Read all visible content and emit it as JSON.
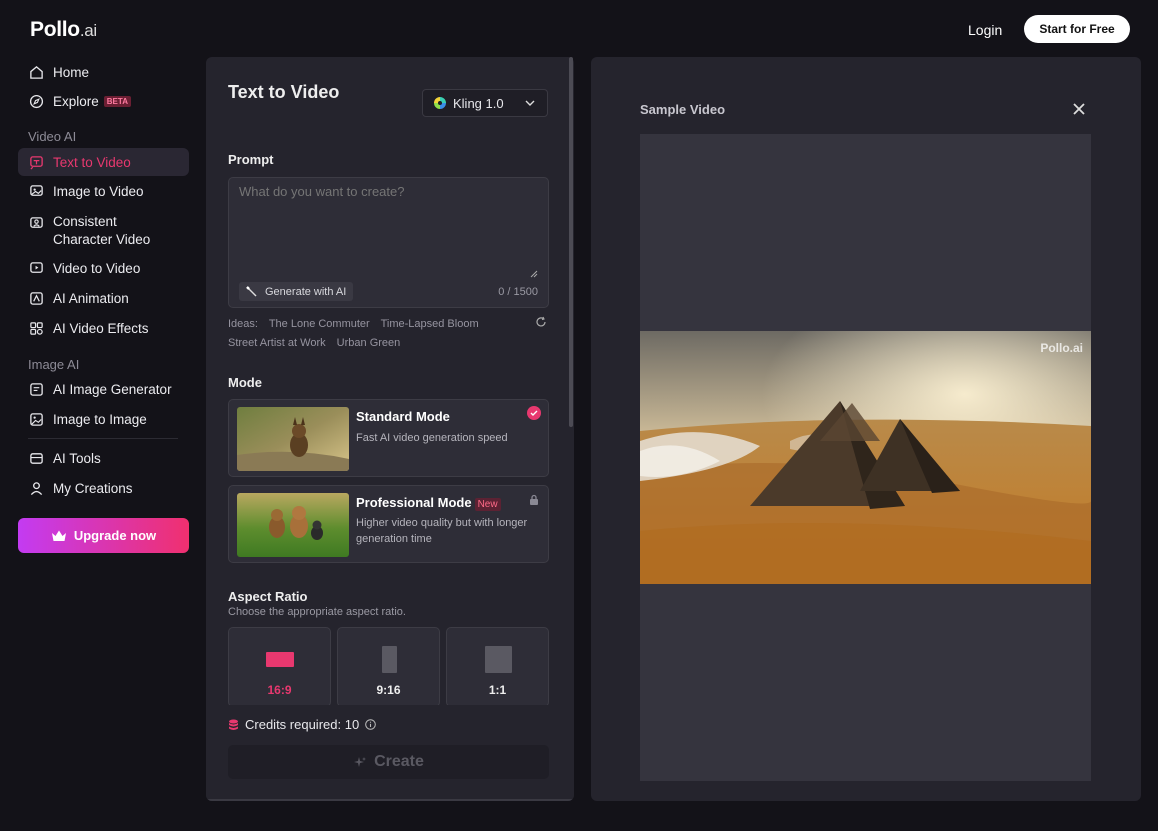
{
  "header": {
    "logo_main": "Pollo",
    "logo_suffix": ".ai",
    "login": "Login",
    "start_free": "Start for Free"
  },
  "sidebar": {
    "home": "Home",
    "explore": "Explore",
    "explore_badge": "BETA",
    "section_video": "Video AI",
    "text_to_video": "Text to Video",
    "image_to_video": "Image to Video",
    "consistent_1": "Consistent",
    "consistent_2": "Character Video",
    "video_to_video": "Video to Video",
    "ai_animation": "AI Animation",
    "ai_video_effects": "AI Video Effects",
    "section_image": "Image AI",
    "ai_image_generator": "AI Image Generator",
    "image_to_image": "Image to Image",
    "ai_tools": "AI Tools",
    "my_creations": "My Creations",
    "upgrade": "Upgrade now"
  },
  "panel": {
    "title": "Text to Video",
    "model": "Kling 1.0",
    "prompt_label": "Prompt",
    "prompt_placeholder": "What do you want to create?",
    "generate_ai": "Generate with AI",
    "counter": "0 / 1500",
    "ideas_label": "Ideas:",
    "ideas": [
      "The Lone Commuter",
      "Time-Lapsed Bloom",
      "Street Artist at Work",
      "Urban Green"
    ],
    "mode_label": "Mode",
    "standard_title": "Standard Mode",
    "standard_desc": "Fast AI video generation speed",
    "pro_title": "Professional Mode",
    "pro_badge": "New",
    "pro_desc": "Higher video quality but with longer generation time",
    "aspect_label": "Aspect Ratio",
    "aspect_sub": "Choose the appropriate aspect ratio.",
    "aspect_options": [
      "16:9",
      "9:16",
      "1:1"
    ],
    "credits": "Credits required: 10",
    "create": "Create"
  },
  "preview": {
    "title": "Sample Video",
    "watermark": "Pollo.ai"
  },
  "colors": {
    "accent": "#e8386f",
    "panel_bg": "#25242d",
    "page_bg": "#131218"
  }
}
